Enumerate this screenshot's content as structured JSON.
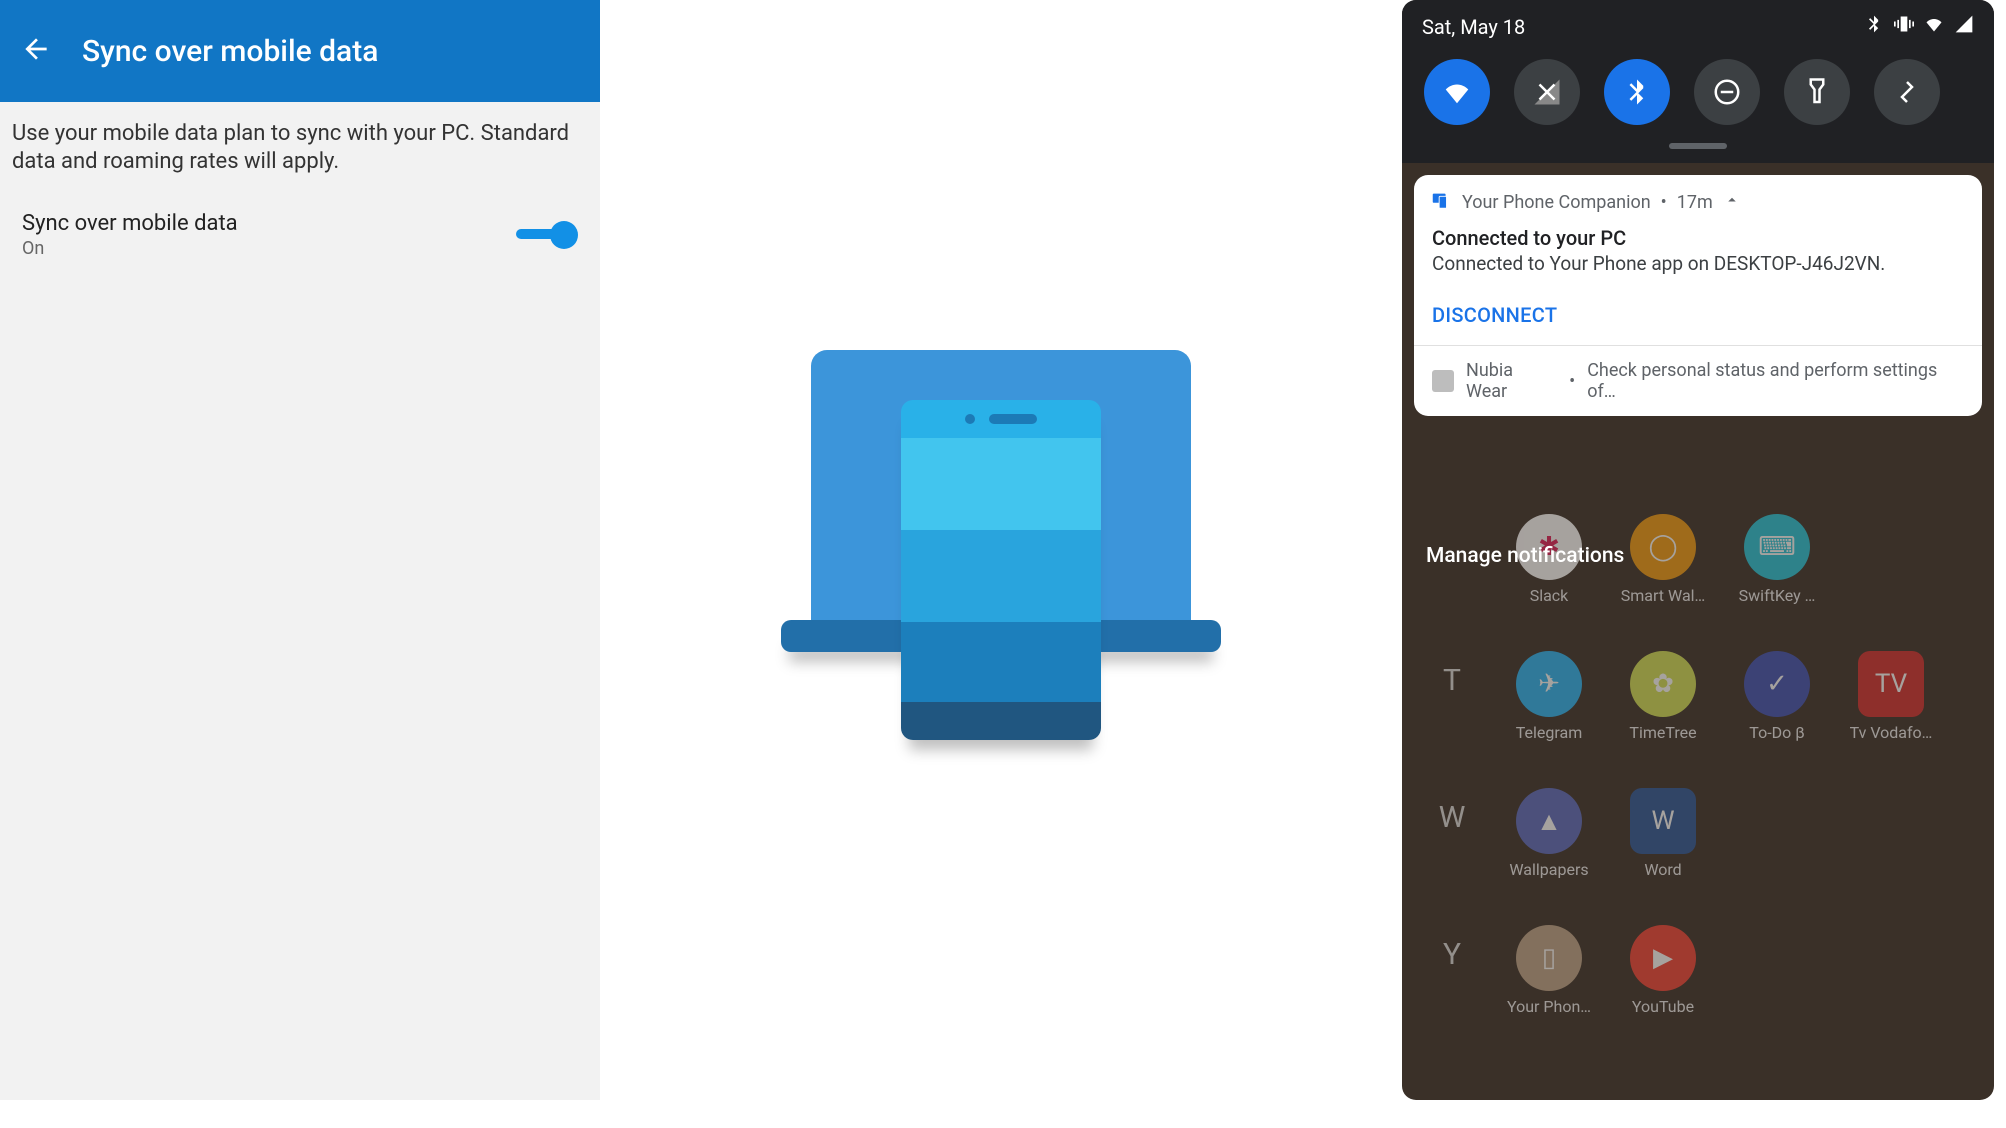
{
  "left": {
    "title": "Sync over mobile data",
    "description": "Use your mobile data plan to sync with your PC. Standard data and roaming rates will apply.",
    "setting_label": "Sync over mobile data",
    "setting_state": "On"
  },
  "shade": {
    "date": "Sat, May 18",
    "quick_settings": [
      {
        "name": "wifi",
        "active": true
      },
      {
        "name": "cellular",
        "active": false
      },
      {
        "name": "bluetooth",
        "active": true
      },
      {
        "name": "dnd",
        "active": false
      },
      {
        "name": "flashlight",
        "active": false
      },
      {
        "name": "rotate",
        "active": false
      }
    ]
  },
  "notification1": {
    "app": "Your Phone Companion",
    "time": "17m",
    "title": "Connected to your PC",
    "text": "Connected to Your Phone app on DESKTOP-J46J2VN.",
    "action": "DISCONNECT"
  },
  "notification2": {
    "app": "Nubia Wear",
    "text": "Check personal status and perform settings of…"
  },
  "manage_label": "Manage notifications",
  "apps": {
    "rows": [
      {
        "letter": "",
        "items": [
          "Slack",
          "Smart Wal…",
          "SwiftKey …"
        ]
      },
      {
        "letter": "T",
        "items": [
          "Telegram",
          "TimeTree",
          "To-Do β",
          "Tv Vodafo…"
        ]
      },
      {
        "letter": "W",
        "items": [
          "Wallpapers",
          "Word"
        ]
      },
      {
        "letter": "Y",
        "items": [
          "Your Phon…",
          "YouTube"
        ]
      }
    ]
  },
  "colors": {
    "accent_blue": "#1176c5",
    "toggle_blue": "#1290e6",
    "google_blue": "#1a73e8"
  }
}
